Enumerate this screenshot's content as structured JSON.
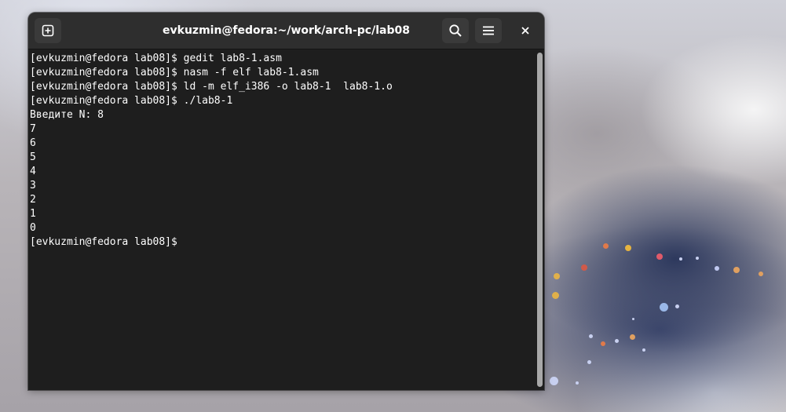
{
  "window": {
    "title": "evkuzmin@fedora:~/work/arch-pc/lab08"
  },
  "headerbar": {
    "new_tab_icon": "new-tab-icon",
    "search_icon": "search-icon",
    "menu_icon": "hamburger-menu-icon",
    "close_icon": "close-icon"
  },
  "terminal": {
    "lines": [
      "[evkuzmin@fedora lab08]$ gedit lab8-1.asm",
      "[evkuzmin@fedora lab08]$ nasm -f elf lab8-1.asm",
      "[evkuzmin@fedora lab08]$ ld -m elf_i386 -o lab8-1  lab8-1.o",
      "[evkuzmin@fedora lab08]$ ./lab8-1",
      "Введите N: 8",
      "7",
      "6",
      "5",
      "4",
      "3",
      "2",
      "1",
      "0",
      "[evkuzmin@fedora lab08]$ "
    ]
  },
  "colors": {
    "terminal_bg": "#1e1e1e",
    "headerbar_bg": "#2e2e2e",
    "text": "#ffffff"
  }
}
